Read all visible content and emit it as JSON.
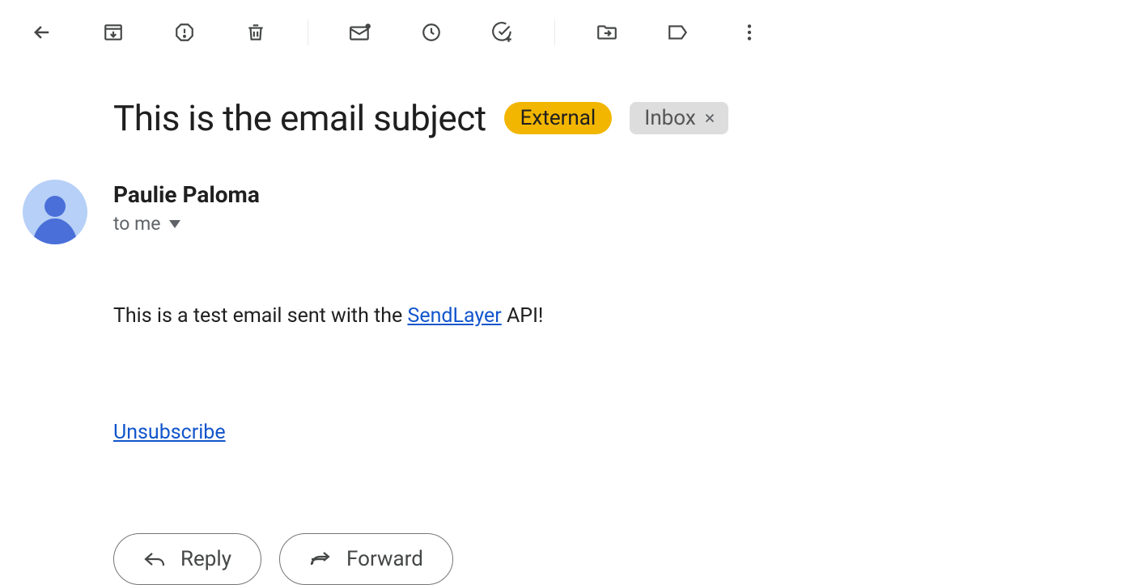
{
  "subject": "This is the email subject",
  "badges": {
    "external": "External",
    "inbox": "Inbox"
  },
  "sender": {
    "name": "Paulie Paloma",
    "to_line": "to me"
  },
  "body": {
    "before_link": "This is a test email sent with the ",
    "link_text": "SendLayer",
    "after_link": " API!"
  },
  "unsubscribe_text": "Unsubscribe",
  "actions": {
    "reply": "Reply",
    "forward": "Forward"
  }
}
